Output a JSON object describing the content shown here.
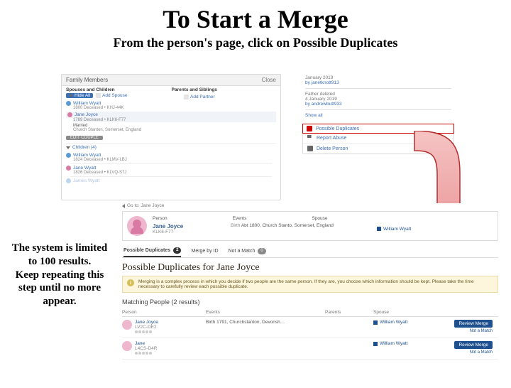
{
  "title": "To Start a Merge",
  "subtitle": "From the person's page, click on Possible  Duplicates",
  "sidenote": "The system is limited to 100 results.\nKeep repeating this step until no more appear.",
  "top": {
    "panel_header": "Family Members",
    "close_label": "Close",
    "col_left": "Spouses and Children",
    "col_right": "Parents and Siblings",
    "hide_all": "Hide All",
    "add_spouse": "Add Spouse",
    "add_partner": "Add Partner",
    "husband": {
      "name": "William Wyatt",
      "sub": "1800 Deceased • KHJ-44K"
    },
    "wife": {
      "name": "Jane Joyce",
      "sub": "1789 Deceased • KLK6-F77"
    },
    "marriage_label": "Married",
    "marriage_place": "Church Stanton, Somerset, England",
    "edit_couple": "EDIT COUPLE",
    "children_toggle": "Children (4)",
    "child1": {
      "name": "William Wyatt",
      "sub": "1824 Deceased • KLMV-LBJ"
    },
    "child2": {
      "name": "Jane Wyatt",
      "sub": "1826 Deceased • KLVQ-S7J"
    },
    "child3": {
      "name": "James Wyatt"
    },
    "meta": {
      "line1a": "January 2019",
      "line1b": "by janetknott913",
      "line2a": "Father deleted",
      "line2b": "4 January 2019",
      "line2c": "by andrewbutt933",
      "show_all": "Show all"
    },
    "tools": {
      "possible_dup": "Possible Duplicates",
      "report_abuse": "Report Abuse",
      "delete_person": "Delete Person"
    }
  },
  "bottom": {
    "goto": "Go to: Jane Joyce",
    "cols": {
      "person": "Person",
      "events": "Events",
      "spouse": "Spouse"
    },
    "person": {
      "name": "Jane Joyce",
      "pid": "KLK6-F77"
    },
    "birth_label": "Birth",
    "birth_val": "Abt 1800, Church Stanto, Somerset, England",
    "spouse_name": "William Wyatt",
    "tabs": {
      "possible": "Possible Duplicates",
      "possible_count": "2",
      "merge_by_id": "Merge by ID",
      "not_a_match": "Not a Match",
      "not_a_match_count": "0"
    },
    "dup_heading": "Possible Duplicates for Jane Joyce",
    "info_text": "Merging is a complex process in which you decide if two people are the same person. If they are, you choose which information should be kept. Please take the time necessary to carefully review each possible duplicate.",
    "matching_header": "Matching People  (2 results)",
    "table_head": {
      "person": "Person",
      "events": "Events",
      "parents": "Parents",
      "spouse": "Spouse"
    },
    "rows": [
      {
        "name": "Jane Joyce",
        "pid": "LV2C-DE2",
        "events": "Birth  1791, Churchstanton, Devonsh…",
        "spouse": "William Wyatt",
        "action": "Review Merge",
        "nota": "Not a Match"
      },
      {
        "name": "Jane",
        "pid": "L4CS-D4R",
        "events": "",
        "spouse": "William Wyatt",
        "action": "Review Merge",
        "nota": "Not a Match"
      }
    ]
  }
}
